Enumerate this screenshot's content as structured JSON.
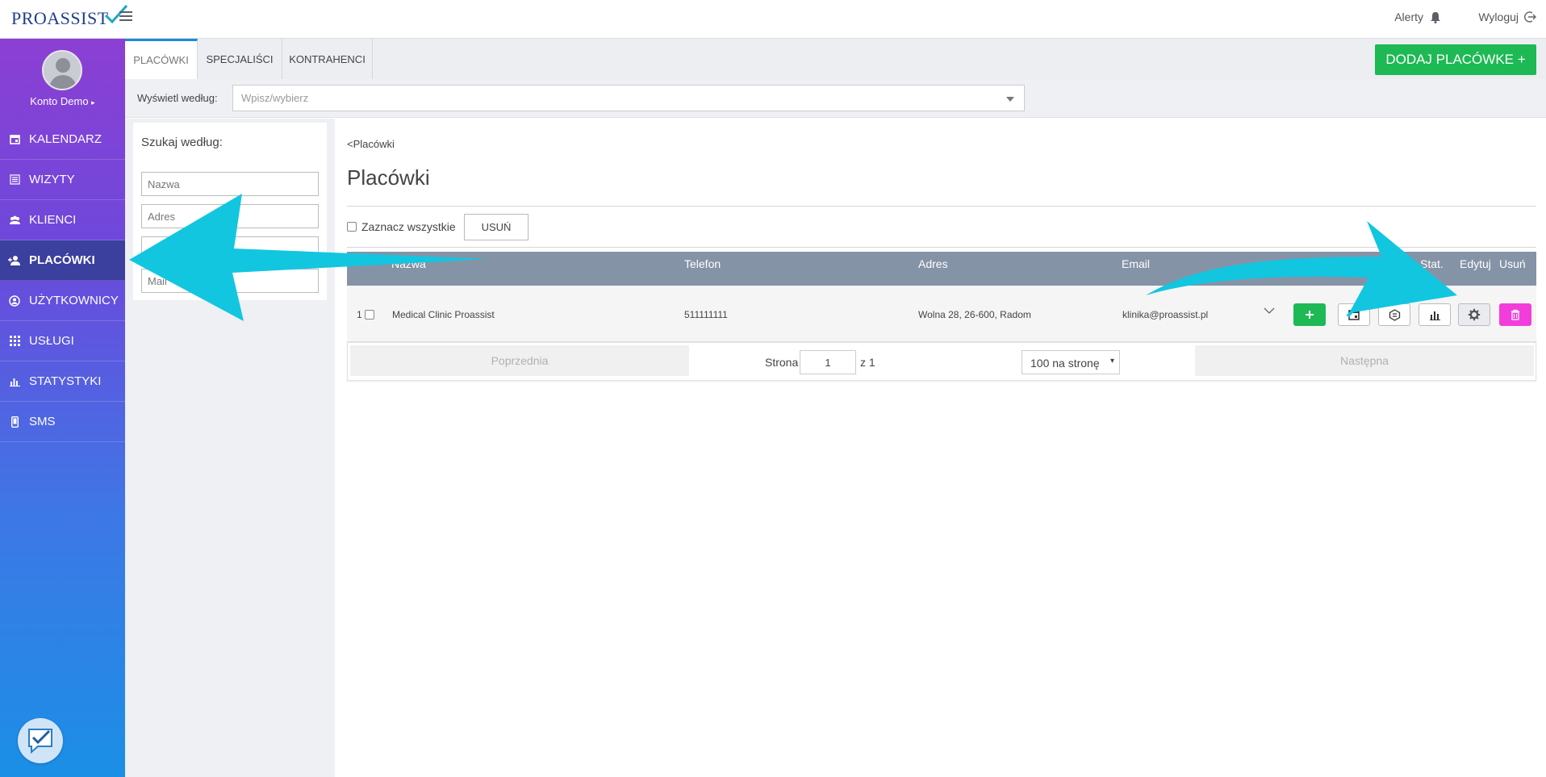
{
  "header": {
    "logo_text": "PROASSIST",
    "alerts_label": "Alerty",
    "logout_label": "Wyloguj"
  },
  "sidebar": {
    "account_name": "Konto Demo",
    "items": [
      {
        "label": "KALENDARZ",
        "icon": "calendar-icon"
      },
      {
        "label": "WIZYTY",
        "icon": "list-icon"
      },
      {
        "label": "KLIENCI",
        "icon": "users-icon"
      },
      {
        "label": "PLACÓWKI",
        "icon": "user-add-icon",
        "active": true
      },
      {
        "label": "UŻYTKOWNICY",
        "icon": "user-circle-icon"
      },
      {
        "label": "USŁUGI",
        "icon": "grid-icon"
      },
      {
        "label": "STATYSTYKI",
        "icon": "bar-chart-icon"
      },
      {
        "label": "SMS",
        "icon": "phone-icon"
      }
    ]
  },
  "tabs": [
    {
      "label": "PLACÓWKI",
      "active": true
    },
    {
      "label": "SPECJALIŚCI"
    },
    {
      "label": "KONTRAHENCI"
    }
  ],
  "add_button": "DODAJ PLACÓWKE +",
  "filter": {
    "label": "Wyświetl według:",
    "placeholder": "Wpisz/wybierz"
  },
  "search": {
    "title": "Szukaj według:",
    "fields": [
      "Nazwa",
      "Adres",
      "Mail"
    ]
  },
  "main": {
    "breadcrumb": "<Placówki",
    "title": "Placówki",
    "select_all": "Zaznacz wszystkie",
    "delete_button": "USUŃ"
  },
  "table": {
    "columns": {
      "name": "Nazwa",
      "phone": "Telefon",
      "address": "Adres",
      "email": "Email",
      "stat": "Stat.",
      "edit": "Edytuj",
      "delete": "Usuń"
    },
    "rows": [
      {
        "index": "1",
        "name": "Medical Clinic Proassist",
        "phone": "511111111",
        "address": "Wolna 28, 26-600, Radom",
        "email": "klinika@proassist.pl"
      }
    ]
  },
  "pager": {
    "prev": "Poprzednia",
    "next": "Następna",
    "page_label": "Strona",
    "page_value": "1",
    "of_label": "z 1",
    "per_page": "100 na stronę"
  },
  "colors": {
    "accent_green": "#1db954",
    "delete_pink": "#f23ddb",
    "table_header": "#8593a7",
    "annotation_arrow": "#12c6e0"
  }
}
